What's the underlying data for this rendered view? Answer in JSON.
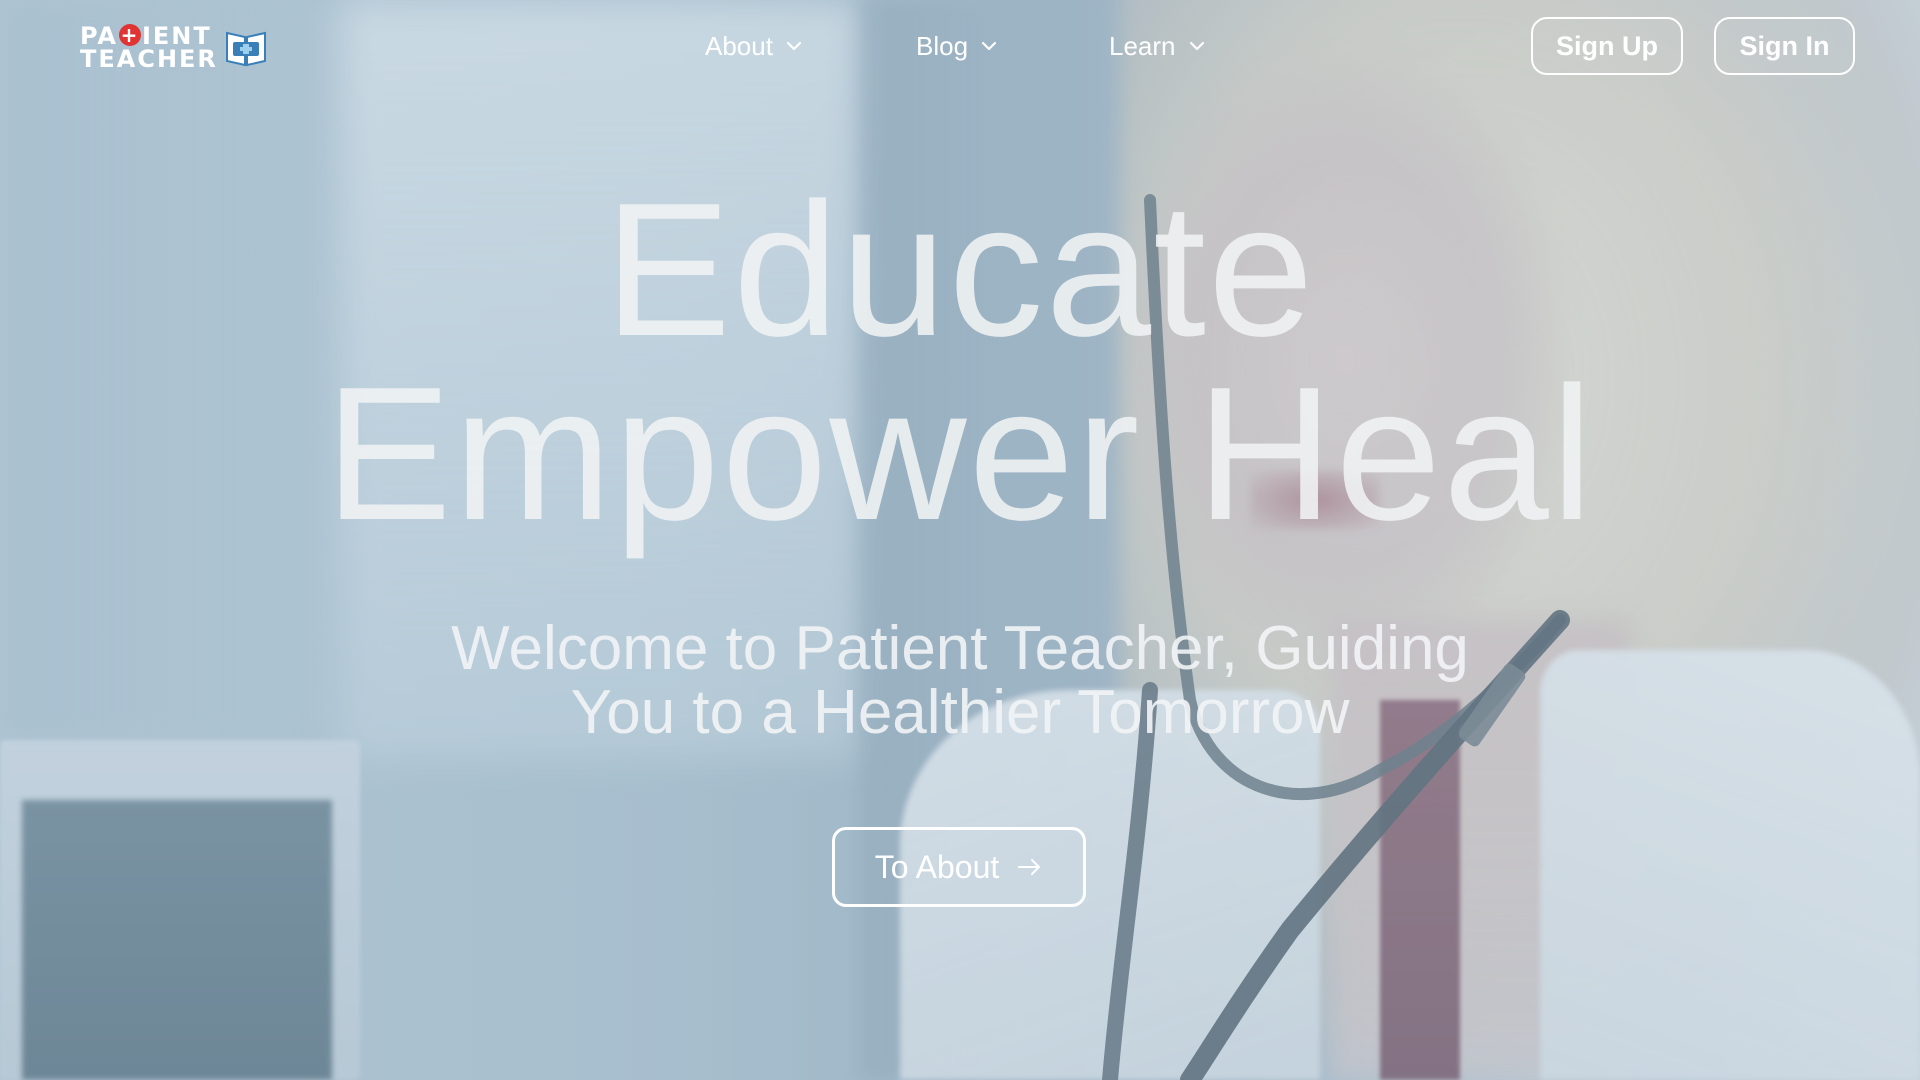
{
  "brand": {
    "name_line1_part1": "PA",
    "name_line1_cross": "+",
    "name_line1_part2": "IENT",
    "name_line2": "TEACHER",
    "logo_icon": "book-cross-icon",
    "colors": {
      "cross_red": "#e03434",
      "book_blue": "#3a7fb8"
    }
  },
  "nav": {
    "items": [
      {
        "label": "About",
        "icon": "chevron-down-icon"
      },
      {
        "label": "Blog",
        "icon": "chevron-down-icon"
      },
      {
        "label": "Learn",
        "icon": "chevron-down-icon"
      }
    ]
  },
  "auth": {
    "signup_label": "Sign Up",
    "signin_label": "Sign In"
  },
  "hero": {
    "headline_line1": "Educate",
    "headline_line2": "Empower Heal",
    "subtitle_line1": "Welcome to Patient Teacher, Guiding",
    "subtitle_line2": "You to a Healthier Tomorrow",
    "cta_label": "To About",
    "cta_icon": "arrow-right-icon"
  },
  "theme": {
    "text_color": "#ffffff",
    "overlay_tint": "#96b4c8"
  }
}
